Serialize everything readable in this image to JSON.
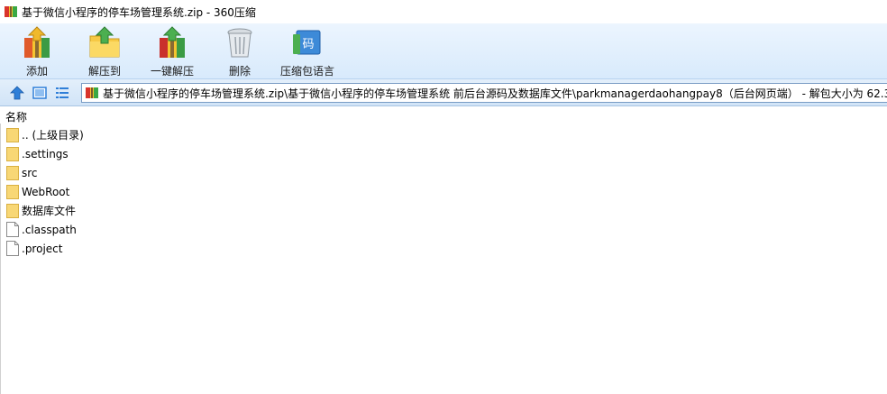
{
  "window": {
    "title": "基于微信小程序的停车场管理系统.zip - 360压缩"
  },
  "toolbar": {
    "items": [
      {
        "label": "添加",
        "icon": "add-archive-icon"
      },
      {
        "label": "解压到",
        "icon": "extract-to-icon"
      },
      {
        "label": "一键解压",
        "icon": "one-click-extract-icon"
      },
      {
        "label": "删除",
        "icon": "delete-icon"
      },
      {
        "label": "压缩包语言",
        "icon": "archive-language-icon"
      }
    ]
  },
  "address": {
    "path": "基于微信小程序的停车场管理系统.zip\\基于微信小程序的停车场管理系统 前后台源码及数据库文件\\parkmanagerdaohangpay8（后台网页端） - 解包大小为 62.3"
  },
  "list": {
    "column_name": "名称",
    "items": [
      {
        "name": ".. (上级目录)",
        "type": "folder"
      },
      {
        "name": ".settings",
        "type": "folder"
      },
      {
        "name": "src",
        "type": "folder"
      },
      {
        "name": "WebRoot",
        "type": "folder"
      },
      {
        "name": "数据库文件",
        "type": "folder"
      },
      {
        "name": ".classpath",
        "type": "file"
      },
      {
        "name": ".project",
        "type": "file"
      }
    ]
  },
  "colors": {
    "folder": "#f8d775",
    "toolbar_bg": "#dbeafb",
    "accent_blue": "#2f7fd8"
  }
}
